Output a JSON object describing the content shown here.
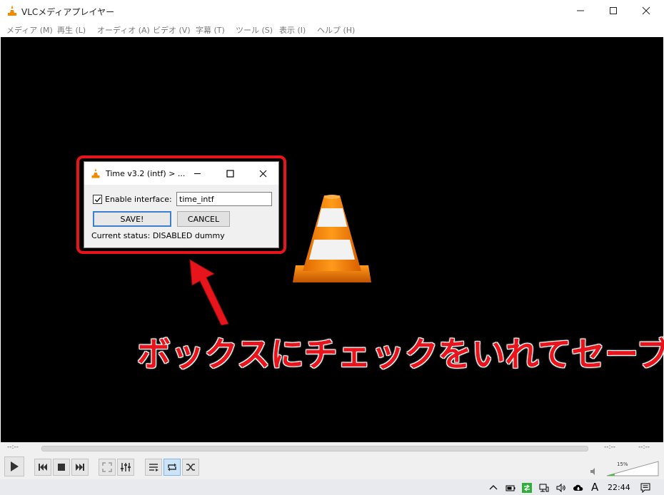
{
  "window": {
    "title": "VLCメディアプレイヤー",
    "icon": "vlc-cone-icon"
  },
  "menu": [
    "メディア (M)",
    "再生 (L)",
    "オーディオ (A)",
    "ビデオ (V)",
    "字幕 (T)",
    "ツール (S)",
    "表示 (I)",
    "ヘルプ (H)"
  ],
  "dialog": {
    "title": "Time v3.2 (intf) > ...",
    "checkbox_label": "Enable interface:",
    "checkbox_checked": true,
    "input_value": "time_intf",
    "save_label": "SAVE!",
    "cancel_label": "CANCEL",
    "status_text": "Current status: DISABLED dummy"
  },
  "annotation": {
    "text": "ボックスにチェックをいれてセーブ",
    "color": "#e8141c"
  },
  "player": {
    "time_left": "--:--",
    "time_right_1": "--:--",
    "time_right_2": "--:--",
    "volume_percent": "15%",
    "volume_level": 0.15
  },
  "taskbar": {
    "clock": "22:44",
    "ime": "A"
  },
  "colors": {
    "accent_red": "#e8141c",
    "vlc_orange": "#f08a00",
    "save_border": "#3c7fd0"
  }
}
